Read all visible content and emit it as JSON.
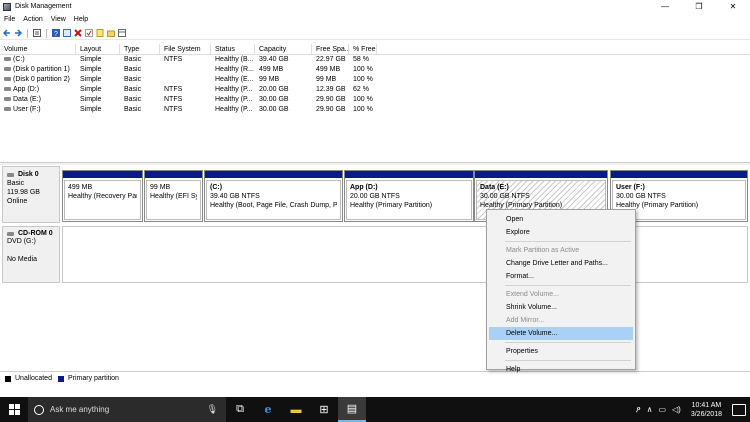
{
  "window": {
    "title": "Disk Management",
    "minimize": "—",
    "maximize": "❐",
    "close": "✕"
  },
  "menu": [
    "File",
    "Action",
    "View",
    "Help"
  ],
  "toolbar_icons": [
    "back-icon",
    "forward-icon",
    "list-icon",
    "help-icon",
    "properties-icon",
    "delete-icon",
    "check-icon",
    "new-icon",
    "folder-icon",
    "view-icon"
  ],
  "columns": [
    "Volume",
    "Layout",
    "Type",
    "File System",
    "Status",
    "Capacity",
    "Free Spa...",
    "% Free"
  ],
  "volumes": [
    [
      "(C:)",
      "Simple",
      "Basic",
      "NTFS",
      "Healthy (B...",
      "39.40 GB",
      "22.97 GB",
      "58 %"
    ],
    [
      "(Disk 0 partition 1)",
      "Simple",
      "Basic",
      "",
      "Healthy (R...",
      "499 MB",
      "499 MB",
      "100 %"
    ],
    [
      "(Disk 0 partition 2)",
      "Simple",
      "Basic",
      "",
      "Healthy (E...",
      "99 MB",
      "99 MB",
      "100 %"
    ],
    [
      "App (D:)",
      "Simple",
      "Basic",
      "NTFS",
      "Healthy (P...",
      "20.00 GB",
      "12.39 GB",
      "62 %"
    ],
    [
      "Data (E:)",
      "Simple",
      "Basic",
      "NTFS",
      "Healthy (P...",
      "30.00 GB",
      "29.90 GB",
      "100 %"
    ],
    [
      "User (F:)",
      "Simple",
      "Basic",
      "NTFS",
      "Healthy (P...",
      "30.00 GB",
      "29.90 GB",
      "100 %"
    ]
  ],
  "disk0": {
    "name": "Disk 0",
    "type": "Basic",
    "size": "119.98 GB",
    "status": "Online",
    "partitions": [
      {
        "title": "",
        "size": "499 MB",
        "status": "Healthy (Recovery Parti"
      },
      {
        "title": "",
        "size": "99 MB",
        "status": "Healthy (EFI Syst"
      },
      {
        "title": "(C:)",
        "size": "39.40 GB NTFS",
        "status": "Healthy (Boot, Page File, Crash Dump, Prir"
      },
      {
        "title": "App  (D:)",
        "size": "20.00 GB NTFS",
        "status": "Healthy (Primary Partition)"
      },
      {
        "title": "Data  (E:)",
        "size": "30.00 GB NTFS",
        "status": "Healthy (Primary Partition)"
      },
      {
        "title": "User  (F:)",
        "size": "30.00 GB NTFS",
        "status": "Healthy (Primary Partition)"
      }
    ]
  },
  "cdrom": {
    "name": "CD-ROM 0",
    "type": "DVD (G:)",
    "media": "No Media"
  },
  "legend": {
    "unallocated": "Unallocated",
    "primary": "Primary partition"
  },
  "context_menu": [
    {
      "label": "Open",
      "state": "enabled"
    },
    {
      "label": "Explore",
      "state": "enabled"
    },
    {
      "sep": true
    },
    {
      "label": "Mark Partition as Active",
      "state": "disabled"
    },
    {
      "label": "Change Drive Letter and Paths...",
      "state": "enabled"
    },
    {
      "label": "Format...",
      "state": "enabled"
    },
    {
      "sep": true
    },
    {
      "label": "Extend Volume...",
      "state": "disabled"
    },
    {
      "label": "Shrink Volume...",
      "state": "enabled"
    },
    {
      "label": "Add Mirror...",
      "state": "disabled"
    },
    {
      "label": "Delete Volume...",
      "state": "highlighted"
    },
    {
      "sep": true
    },
    {
      "label": "Properties",
      "state": "enabled"
    },
    {
      "sep": true
    },
    {
      "label": "Help",
      "state": "enabled"
    }
  ],
  "taskbar": {
    "search_placeholder": "Ask me anything",
    "time": "10:41 AM",
    "date": "3/26/2018"
  },
  "colors": {
    "primary_partition": "#0a1a8c",
    "unallocated": "#000000",
    "highlight": "#a9d0f5"
  }
}
